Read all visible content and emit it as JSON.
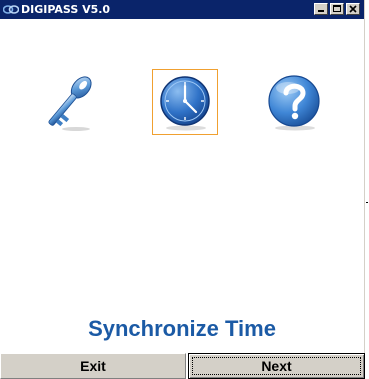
{
  "window": {
    "title": "DIGIPASS V5.0",
    "title_bar_color": "#0a246a"
  },
  "title_buttons": {
    "minimize_icon": "minimize-icon",
    "maximize_icon": "maximize-icon",
    "close_icon": "close-icon"
  },
  "toolbar": {
    "items": [
      {
        "icon": "key-icon",
        "selected": false
      },
      {
        "icon": "clock-icon",
        "selected": true
      },
      {
        "icon": "help-icon",
        "selected": false
      }
    ]
  },
  "main": {
    "heading": "Synchronize Time",
    "heading_color": "#1b5aa5"
  },
  "footer": {
    "exit_label": "Exit",
    "next_label": "Next"
  }
}
